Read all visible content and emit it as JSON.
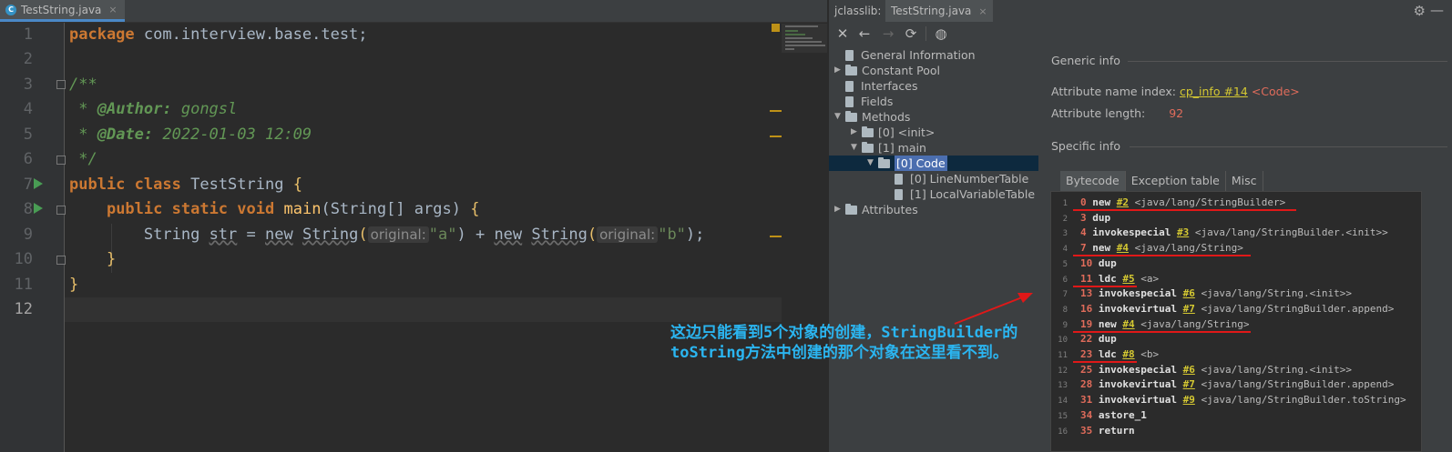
{
  "editor": {
    "tab": {
      "icon": "java-class-icon",
      "label": "TestString.java",
      "close": "×"
    },
    "line_numbers": [
      "1",
      "2",
      "3",
      "4",
      "5",
      "6",
      "7",
      "8",
      "9",
      "10",
      "11",
      "12"
    ],
    "lines": {
      "l1": {
        "kw": "package",
        "rest": " com.interview.base.test;"
      },
      "l3": "/**",
      "l4": {
        "star": " * ",
        "tag": "@Author:",
        "text": " gongsl"
      },
      "l5": {
        "star": " * ",
        "tag": "@Date:",
        "text": " 2022-01-03 12:09"
      },
      "l6": " */",
      "l7": {
        "kw1": "public",
        "kw2": "class",
        "name": "TestString",
        "brace": "{"
      },
      "l8": {
        "kw1": "public",
        "kw2": "static",
        "kw3": "void",
        "fn": "main",
        "params": "(String[] args) ",
        "brace": "{"
      },
      "l9": {
        "type": "String",
        "var": "str",
        "eq": " = ",
        "new1": "new",
        "cls1": "String",
        "hint1": "original:",
        "str1": "\"a\"",
        "plus": ") + ",
        "new2": "new",
        "cls2": "String",
        "hint2": "original:",
        "str2": "\"b\"",
        "end": ");"
      },
      "l10": "}",
      "l11": "}"
    }
  },
  "jclasslib": {
    "title": "jclasslib:",
    "tab_label": "TestString.java",
    "close": "×",
    "toolbar": {
      "close": "✕",
      "back": "←",
      "forward": "→",
      "refresh": "⟳",
      "web": "◍"
    },
    "tree": {
      "general": "General Information",
      "constant_pool": "Constant Pool",
      "interfaces": "Interfaces",
      "fields": "Fields",
      "methods": "Methods",
      "init": "[0] <init>",
      "main": "[1] main",
      "code": "[0] Code",
      "lnt": "[0] LineNumberTable",
      "lvt": "[1] LocalVariableTable",
      "attributes": "Attributes"
    },
    "generic_info": {
      "heading": "Generic info",
      "name_index_label": "Attribute name index:",
      "name_index_link": "cp_info #14",
      "name_index_value": "<Code>",
      "length_label": "Attribute length:",
      "length_value": "92"
    },
    "specific_info": {
      "heading": "Specific info"
    },
    "tabs": [
      "Bytecode",
      "Exception table",
      "Misc"
    ],
    "bytecode": [
      {
        "n": "1",
        "off": "0",
        "op": "new",
        "ref": "#2",
        "cmt": "<java/lang/StringBuilder>"
      },
      {
        "n": "2",
        "off": "3",
        "op": "dup",
        "ref": "",
        "cmt": ""
      },
      {
        "n": "3",
        "off": "4",
        "op": "invokespecial",
        "ref": "#3",
        "cmt": "<java/lang/StringBuilder.<init>>"
      },
      {
        "n": "4",
        "off": "7",
        "op": "new",
        "ref": "#4",
        "cmt": "<java/lang/String>"
      },
      {
        "n": "5",
        "off": "10",
        "op": "dup",
        "ref": "",
        "cmt": ""
      },
      {
        "n": "6",
        "off": "11",
        "op": "ldc",
        "ref": "#5",
        "cmt": "<a>"
      },
      {
        "n": "7",
        "off": "13",
        "op": "invokespecial",
        "ref": "#6",
        "cmt": "<java/lang/String.<init>>"
      },
      {
        "n": "8",
        "off": "16",
        "op": "invokevirtual",
        "ref": "#7",
        "cmt": "<java/lang/StringBuilder.append>"
      },
      {
        "n": "9",
        "off": "19",
        "op": "new",
        "ref": "#4",
        "cmt": "<java/lang/String>"
      },
      {
        "n": "10",
        "off": "22",
        "op": "dup",
        "ref": "",
        "cmt": ""
      },
      {
        "n": "11",
        "off": "23",
        "op": "ldc",
        "ref": "#8",
        "cmt": "<b>"
      },
      {
        "n": "12",
        "off": "25",
        "op": "invokespecial",
        "ref": "#6",
        "cmt": "<java/lang/String.<init>>"
      },
      {
        "n": "13",
        "off": "28",
        "op": "invokevirtual",
        "ref": "#7",
        "cmt": "<java/lang/StringBuilder.append>"
      },
      {
        "n": "14",
        "off": "31",
        "op": "invokevirtual",
        "ref": "#9",
        "cmt": "<java/lang/StringBuilder.toString>"
      },
      {
        "n": "15",
        "off": "34",
        "op": "astore_1",
        "ref": "",
        "cmt": ""
      },
      {
        "n": "16",
        "off": "35",
        "op": "return",
        "ref": "",
        "cmt": ""
      }
    ]
  },
  "annotation": {
    "line1": "这边只能看到5个对象的创建，StringBuilder的",
    "line2": "toString方法中创建的那个对象在这里看不到。",
    "color": "#2bb5f0",
    "arrow_color": "#e01818"
  }
}
